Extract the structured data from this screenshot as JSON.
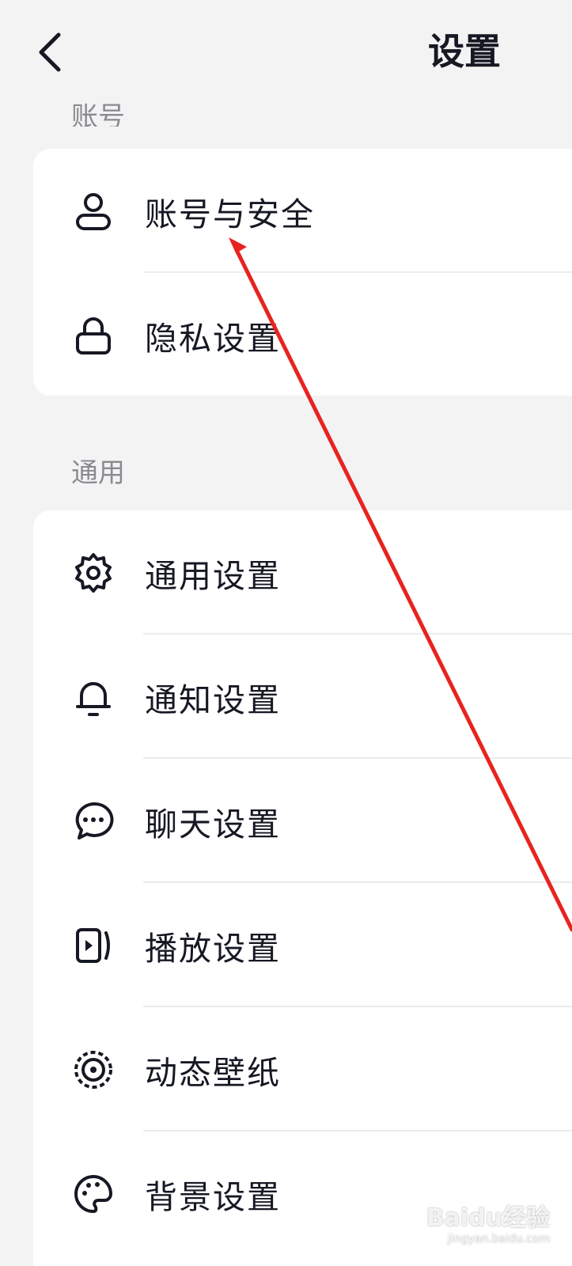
{
  "header": {
    "title": "设置",
    "back_icon": "chevron-left-icon"
  },
  "sections": {
    "account_label": "账号",
    "general_label": "通用"
  },
  "account_items": [
    {
      "label": "账号与安全",
      "icon": "user-icon"
    },
    {
      "label": "隐私设置",
      "icon": "lock-icon"
    }
  ],
  "general_items": [
    {
      "label": "通用设置",
      "icon": "gear-icon"
    },
    {
      "label": "通知设置",
      "icon": "bell-icon"
    },
    {
      "label": "聊天设置",
      "icon": "chat-bubble-icon"
    },
    {
      "label": "播放设置",
      "icon": "play-icon"
    },
    {
      "label": "动态壁纸",
      "icon": "wallpaper-icon"
    },
    {
      "label": "背景设置",
      "icon": "palette-icon"
    }
  ],
  "annotation": {
    "color": "#e8231f"
  },
  "watermark": {
    "text": "Baidu经验",
    "subtext": "jingyan.baidu.com"
  }
}
